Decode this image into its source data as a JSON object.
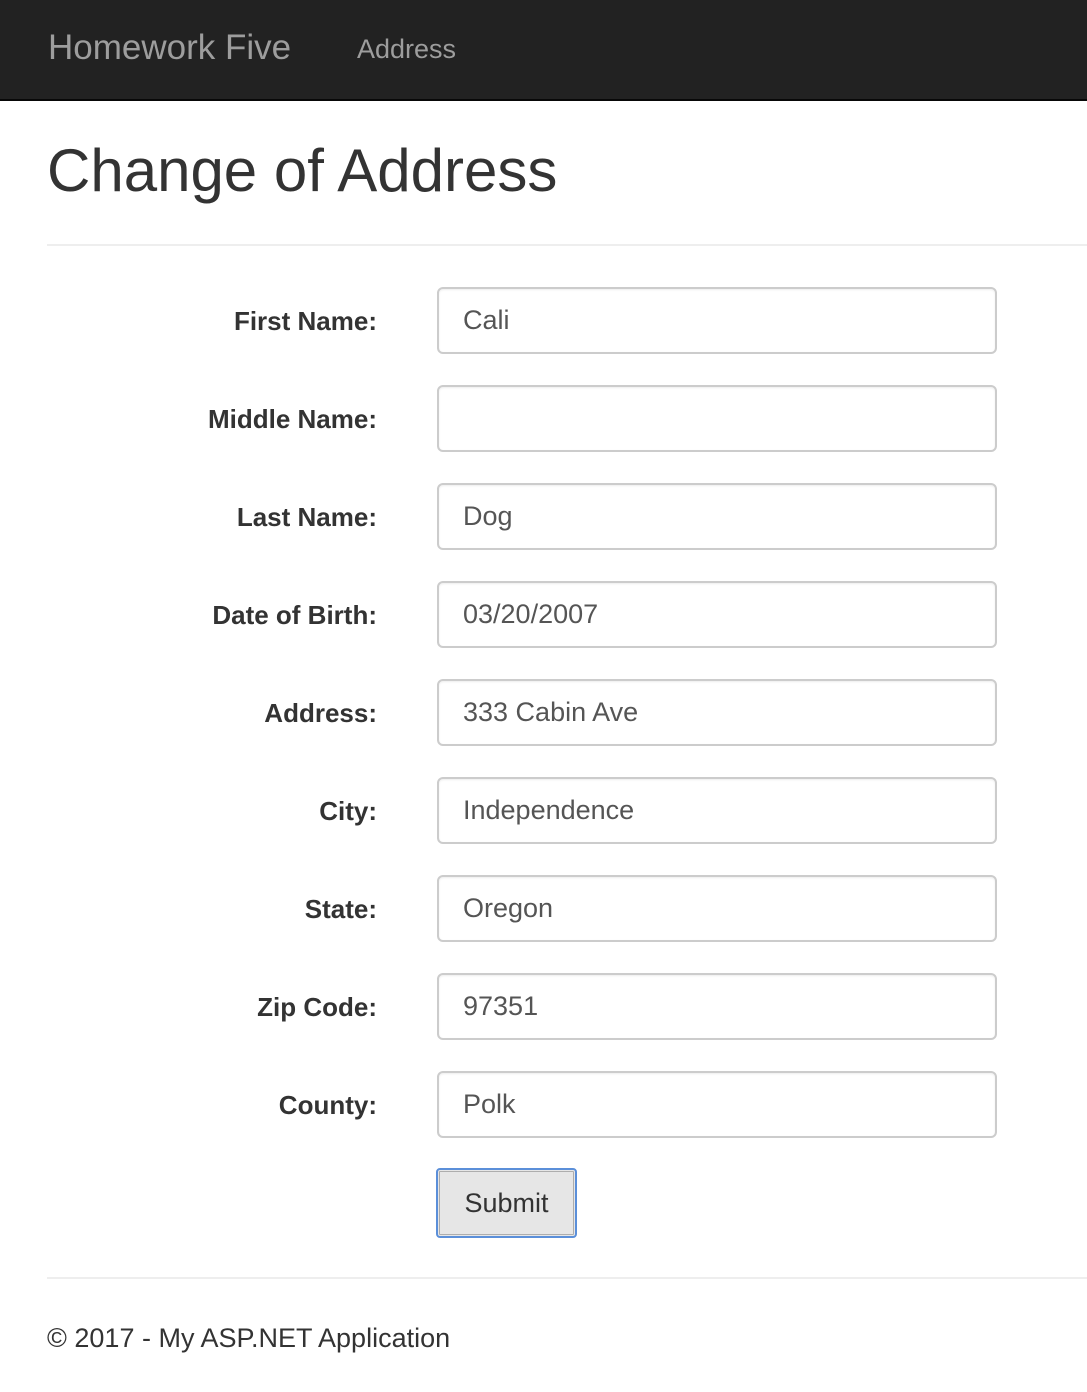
{
  "navbar": {
    "brand": "Homework Five",
    "links": [
      "Address"
    ]
  },
  "page": {
    "title": "Change of Address"
  },
  "form": {
    "fields": [
      {
        "label": "First Name:",
        "value": "Cali"
      },
      {
        "label": "Middle Name:",
        "value": ""
      },
      {
        "label": "Last Name:",
        "value": "Dog"
      },
      {
        "label": "Date of Birth:",
        "value": "03/20/2007"
      },
      {
        "label": "Address:",
        "value": "333 Cabin Ave"
      },
      {
        "label": "City:",
        "value": "Independence"
      },
      {
        "label": "State:",
        "value": "Oregon"
      },
      {
        "label": "Zip Code:",
        "value": "97351"
      },
      {
        "label": "County:",
        "value": "Polk"
      }
    ],
    "submit_label": "Submit"
  },
  "footer": {
    "text": "© 2017 - My ASP.NET Application"
  },
  "colors": {
    "navbar_bg": "#222222",
    "navbar_text": "#9d9d9d",
    "button_focus_border": "#5b8fd9"
  }
}
